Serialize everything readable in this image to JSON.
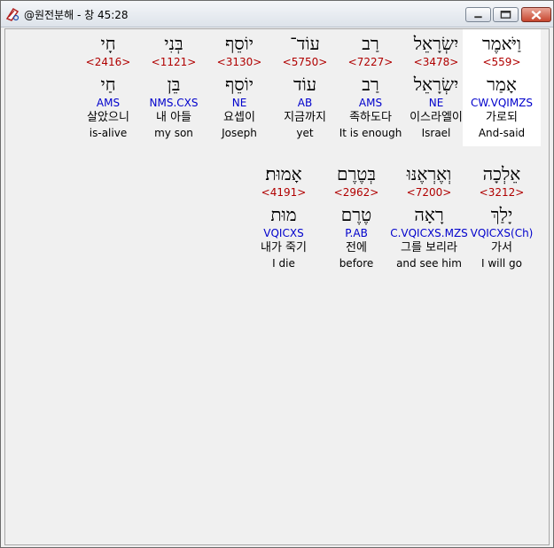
{
  "window": {
    "title": "@원전분해 - 창 45:28",
    "controls": {
      "minimize": "minimize-icon",
      "maximize": "maximize-icon",
      "close": "close-icon"
    }
  },
  "colors": {
    "strong": "#b00000",
    "morph": "#0000cc",
    "highlight": "#ffffff"
  },
  "rows": [
    {
      "words": [
        {
          "hebrew": "וַיֹּאמֶר",
          "strong": "<559>",
          "lemma": "אָמַר",
          "morph": "CW.VQIMZS",
          "korean": "가로되",
          "english": "And-said",
          "selected": true
        },
        {
          "hebrew": "יִשְׂרָאֵל",
          "strong": "<3478>",
          "lemma": "יִשְׂרָאֵל",
          "morph": "NE",
          "korean": "이스라엘이",
          "english": "Israel",
          "selected": false
        },
        {
          "hebrew": "רַב",
          "strong": "<7227>",
          "lemma": "רַב",
          "morph": "AMS",
          "korean": "족하도다",
          "english": "It is enough",
          "selected": false
        },
        {
          "hebrew": "עוֹד־",
          "strong": "<5750>",
          "lemma": "עוֹד",
          "morph": "AB",
          "korean": "지금까지",
          "english": "yet",
          "selected": false
        },
        {
          "hebrew": "יוֹסֵף",
          "strong": "<3130>",
          "lemma": "יוֹסֵף",
          "morph": "NE",
          "korean": "요셉이",
          "english": "Joseph",
          "selected": false
        },
        {
          "hebrew": "בְּנִי",
          "strong": "<1121>",
          "lemma": "בֵּן",
          "morph": "NMS.CXS",
          "korean": "내 아들",
          "english": "my son",
          "selected": false
        },
        {
          "hebrew": "חָי",
          "strong": "<2416>",
          "lemma": "חַי",
          "morph": "AMS",
          "korean": "살았으니",
          "english": "is-alive",
          "selected": false
        }
      ]
    },
    {
      "words": [
        {
          "hebrew": "אֵלְכָה",
          "strong": "<3212>",
          "lemma": "יָלַךְ",
          "morph": "VQICXS(Ch)",
          "korean": "가서",
          "english": "I will go",
          "selected": false
        },
        {
          "hebrew": "וְאֶרְאֶנּוּ",
          "strong": "<7200>",
          "lemma": "רָאָה",
          "morph": "C.VQICXS.MZS",
          "korean": "그를 보리라",
          "english": "and see him",
          "selected": false
        },
        {
          "hebrew": "בְּטֶרֶם",
          "strong": "<2962>",
          "lemma": "טֶרֶם",
          "morph": "P.AB",
          "korean": "전에",
          "english": "before",
          "selected": false
        },
        {
          "hebrew": "אָמוּת׃",
          "strong": "<4191>",
          "lemma": "מוּת",
          "morph": "VQICXS",
          "korean": "내가 죽기",
          "english": "I die",
          "selected": false
        }
      ]
    }
  ]
}
